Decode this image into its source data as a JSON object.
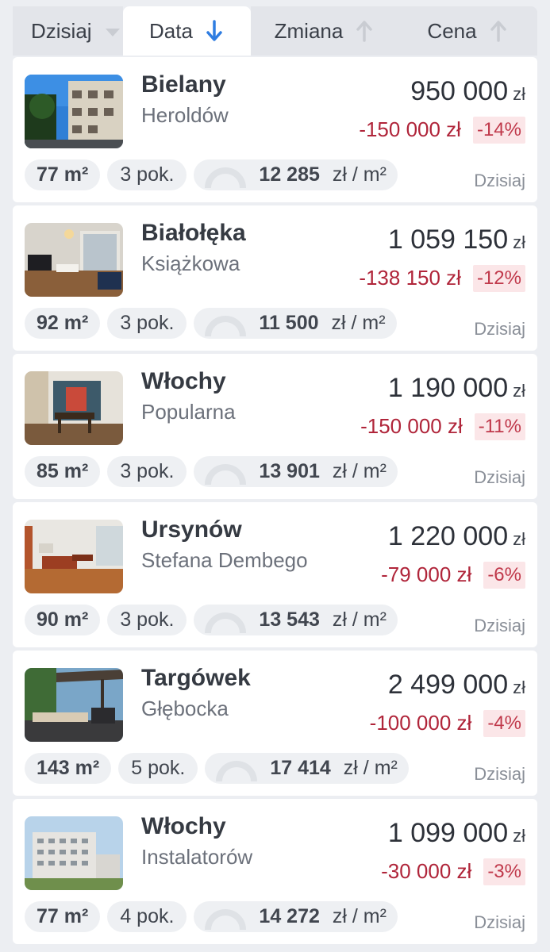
{
  "tabs": [
    {
      "label": "Dzisiaj",
      "icon": "chevron-down-icon",
      "active": false
    },
    {
      "label": "Data",
      "icon": "arrow-down-icon",
      "active": true
    },
    {
      "label": "Zmiana",
      "icon": "arrow-up-icon",
      "active": false
    },
    {
      "label": "Cena",
      "icon": "arrow-up-icon",
      "active": false
    }
  ],
  "colors": {
    "accent": "#2f7de1",
    "negative": "#b0253a",
    "negative_bg": "#fbe6e8",
    "inactive_icon": "#c9ccd2"
  },
  "listings": [
    {
      "district": "Bielany",
      "street": "Heroldów",
      "price": "950 000",
      "currency": "zł",
      "change": "-150 000 zł",
      "pct": "-14%",
      "area": "77 m²",
      "rooms": "3 pok.",
      "ppm": "12 285",
      "ppm_unit": "zł / m²",
      "date": "Dzisiaj",
      "photo": "building-exterior"
    },
    {
      "district": "Białołęka",
      "street": "Książkowa",
      "price": "1 059 150",
      "currency": "zł",
      "change": "-138 150 zł",
      "pct": "-12%",
      "area": "92 m²",
      "rooms": "3 pok.",
      "ppm": "11 500",
      "ppm_unit": "zł / m²",
      "date": "Dzisiaj",
      "photo": "living-room"
    },
    {
      "district": "Włochy",
      "street": "Popularna",
      "price": "1 190 000",
      "currency": "zł",
      "change": "-150 000 zł",
      "pct": "-11%",
      "area": "85 m²",
      "rooms": "3 pok.",
      "ppm": "13 901",
      "ppm_unit": "zł / m²",
      "date": "Dzisiaj",
      "photo": "dining-room"
    },
    {
      "district": "Ursynów",
      "street": "Stefana Dembego",
      "price": "1 220 000",
      "currency": "zł",
      "change": "-79 000 zł",
      "pct": "-6%",
      "area": "90 m²",
      "rooms": "3 pok.",
      "ppm": "13 543",
      "ppm_unit": "zł / m²",
      "date": "Dzisiaj",
      "photo": "lounge"
    },
    {
      "district": "Targówek",
      "street": "Głębocka",
      "price": "2 499 000",
      "currency": "zł",
      "change": "-100 000 zł",
      "pct": "-4%",
      "area": "143 m²",
      "rooms": "5 pok.",
      "ppm": "17 414",
      "ppm_unit": "zł / m²",
      "date": "Dzisiaj",
      "photo": "terrace"
    },
    {
      "district": "Włochy",
      "street": "Instalatorów",
      "price": "1 099 000",
      "currency": "zł",
      "change": "-30 000 zł",
      "pct": "-3%",
      "area": "77 m²",
      "rooms": "4 pok.",
      "ppm": "14 272",
      "ppm_unit": "zł / m²",
      "date": "Dzisiaj",
      "photo": "apartment-block"
    }
  ]
}
